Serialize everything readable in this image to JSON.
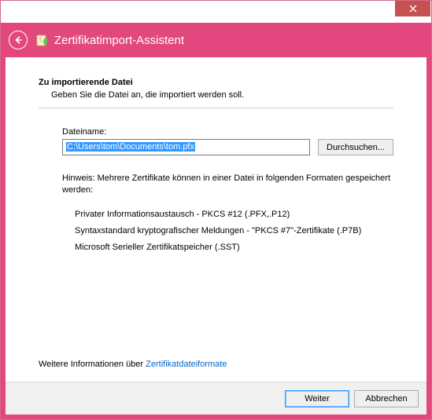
{
  "titlebar": {
    "close_icon": "close"
  },
  "header": {
    "title": "Zertifikatimport-Assistent"
  },
  "section": {
    "title": "Zu importierende Datei",
    "subtitle": "Geben Sie die Datei an, die importiert werden soll."
  },
  "file": {
    "label": "Dateiname:",
    "value": "C:\\Users\\tom\\Documents\\tom.pfx",
    "browse_label": "Durchsuchen..."
  },
  "hint": {
    "text": "Hinweis: Mehrere Zertifikate können in einer Datei in folgenden Formaten gespeichert werden:",
    "formats": [
      "Privater Informationsaustausch - PKCS #12 (.PFX,.P12)",
      "Syntaxstandard kryptografischer Meldungen - \"PKCS #7\"-Zertifikate (.P7B)",
      "Microsoft Serieller Zertifikatspeicher (.SST)"
    ]
  },
  "more": {
    "prefix": "Weitere Informationen über ",
    "link": "Zertifikatdateiformate"
  },
  "footer": {
    "next": "Weiter",
    "cancel": "Abbrechen"
  }
}
